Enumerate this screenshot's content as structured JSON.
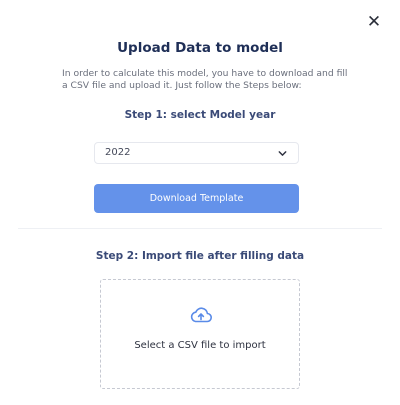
{
  "modal": {
    "close_symbol": "✕",
    "title": "Upload Data to model",
    "description": "In order to calculate this model, you have to download and fill a CSV file and upload it. Just follow the Steps below:"
  },
  "step1": {
    "label": "Step 1: select Model year",
    "year_select": {
      "selected": "2022"
    },
    "download_button_label": "Download Template"
  },
  "step2": {
    "label": "Step 2: Import file after filling data",
    "dropzone_text": "Select a CSV file to import"
  },
  "colors": {
    "accent": "#6492ea",
    "title": "#1f2f57",
    "step_heading": "#3a4a77"
  },
  "icons": {
    "close": "close-icon",
    "dropdown": "chevron-down-icon",
    "upload": "cloud-upload-icon"
  }
}
